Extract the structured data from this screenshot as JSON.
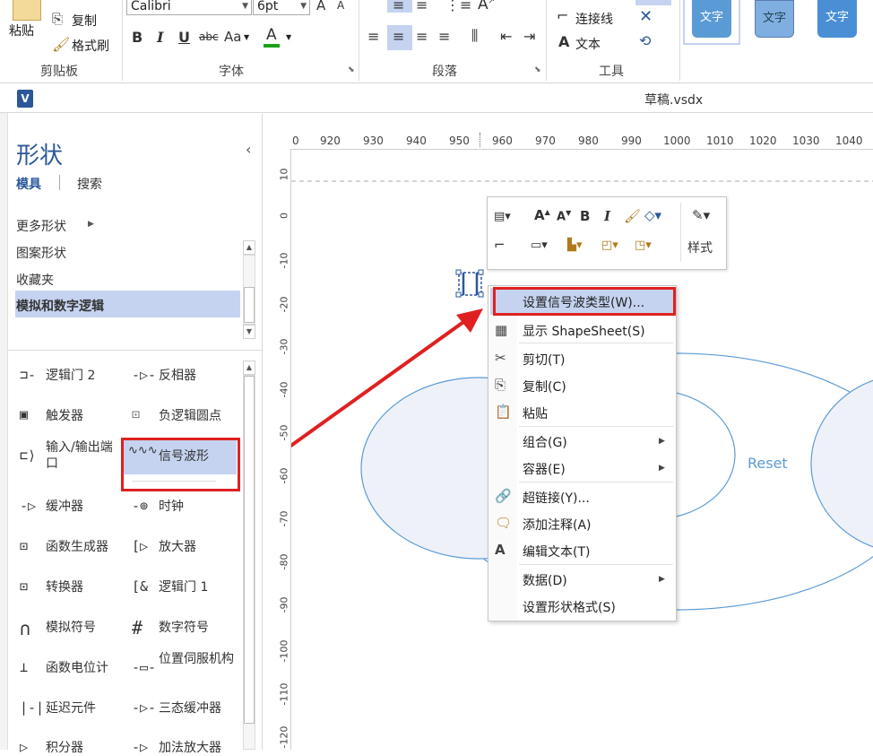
{
  "ribbon": {
    "clipboard": {
      "paste": "粘贴",
      "copy": "复制",
      "format_painter": "格式刷",
      "label": "剪贴板"
    },
    "font": {
      "font_name": "Calibri",
      "font_size": "6pt",
      "label": "字体",
      "bold": "B",
      "italic": "I",
      "underline": "U",
      "strike": "abc",
      "case": "Aa",
      "font_color": "A",
      "grow": "A",
      "shrink": "A"
    },
    "paragraph": {
      "label": "段落"
    },
    "tools": {
      "connector": "连接线",
      "text": "文本",
      "label": "工具",
      "text_icon": "A"
    },
    "styles": {
      "sample1": "文字",
      "sample2": "文字",
      "sample3": "文字"
    }
  },
  "document": {
    "title": "草稿.vsdx",
    "app_icon": "V"
  },
  "shapes_pane": {
    "title": "形状",
    "tab_stencils": "模具",
    "tab_search": "搜索",
    "sections": [
      "更多形状",
      "图案形状",
      "收藏夹",
      "模拟和数字逻辑"
    ],
    "selected_section": "模拟和数字逻辑",
    "collapse_icon": "‹",
    "items_left": [
      "逻辑门 2",
      "触发器",
      "输入/输出端口",
      "缓冲器",
      "函数生成器",
      "转换器",
      "模拟符号",
      "函数电位计",
      "延迟元件",
      "积分器"
    ],
    "items_right": [
      "反相器",
      "负逻辑圆点",
      "信号波形",
      "时钟",
      "放大器",
      "逻辑门 1",
      "数字符号",
      "位置伺服机构",
      "三态缓冲器",
      "加法放大器"
    ],
    "selected_item": "信号波形"
  },
  "ruler": {
    "h_ticks": [
      "0",
      "920",
      "930",
      "940",
      "950",
      "960",
      "970",
      "980",
      "990",
      "1000",
      "1010",
      "1020",
      "1030",
      "1040"
    ],
    "v_ticks": [
      "10",
      "0",
      "-10",
      "-20",
      "-30",
      "-40",
      "-50",
      "-60",
      "-70",
      "-80",
      "-90",
      "-100",
      "-110",
      "-120"
    ]
  },
  "canvas": {
    "shape_label": "Reset"
  },
  "mini_toolbar": {
    "style_label": "样式"
  },
  "context_menu": {
    "items": [
      {
        "label": "设置信号波类型(W)...",
        "icon": "none",
        "highlighted": true
      },
      {
        "label": "显示 ShapeSheet(S)",
        "icon": "table-icon"
      },
      {
        "label": "剪切(T)",
        "icon": "scissors-icon"
      },
      {
        "label": "复制(C)",
        "icon": "copy-icon"
      },
      {
        "label": "粘贴",
        "icon": "paste-icon"
      },
      {
        "label": "组合(G)",
        "submenu": true
      },
      {
        "label": "容器(E)",
        "submenu": true
      },
      {
        "label": "超链接(Y)...",
        "icon": "link-icon"
      },
      {
        "label": "添加注释(A)",
        "icon": "comment-icon"
      },
      {
        "label": "编辑文本(T)",
        "icon": "text-icon"
      },
      {
        "label": "数据(D)",
        "submenu": true
      },
      {
        "label": "设置形状格式(S)"
      }
    ]
  },
  "colors": {
    "accent": "#2b579a",
    "selection": "#c5d3f0",
    "annotation_red": "#e02020",
    "style_fill": "#5b9bd5",
    "shape_text": "#5b9bd5"
  }
}
